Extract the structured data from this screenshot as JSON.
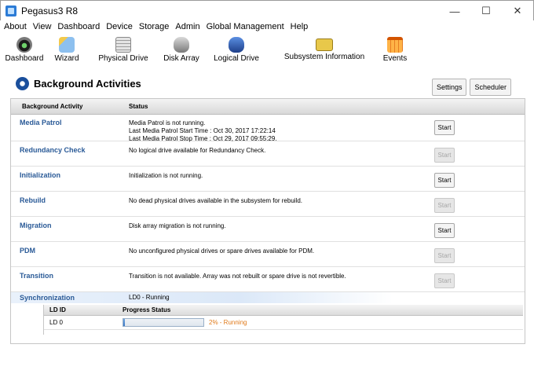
{
  "window": {
    "title": "Pegasus3 R8",
    "controls": {
      "minimize": "—",
      "maximize": "☐",
      "close": "✕"
    }
  },
  "menu": [
    "About",
    "View",
    "Dashboard",
    "Device",
    "Storage",
    "Admin",
    "Global Management",
    "Help"
  ],
  "toolbar": [
    {
      "label": "Dashboard",
      "icon": "dashboard-icon"
    },
    {
      "label": "Wizard",
      "icon": "wizard-icon"
    },
    {
      "label": "Physical Drive",
      "icon": "physical-drive-icon"
    },
    {
      "label": "Disk Array",
      "icon": "disk-array-icon"
    },
    {
      "label": "Logical Drive",
      "icon": "logical-drive-icon"
    },
    {
      "label": "Subsystem Information",
      "icon": "subsystem-info-icon"
    },
    {
      "label": "Events",
      "icon": "events-icon"
    }
  ],
  "panel": {
    "title": "Background Activities",
    "settings_label": "Settings",
    "scheduler_label": "Scheduler"
  },
  "grid": {
    "col_activity": "Background Activity",
    "col_status": "Status",
    "rows": [
      {
        "name": "Media Patrol",
        "status": [
          "Media Patrol is not running.",
          "Last Media Patrol Start Time : Oct 30, 2017 17:22:14",
          "Last Media Patrol Stop Time : Oct 29, 2017 09:55:29."
        ],
        "start_label": "Start",
        "enabled": true
      },
      {
        "name": "Redundancy Check",
        "status": [
          "No logical drive available for Redundancy Check."
        ],
        "start_label": "Start",
        "enabled": false
      },
      {
        "name": "Initialization",
        "status": [
          "Initialization is not running."
        ],
        "start_label": "Start",
        "enabled": true
      },
      {
        "name": "Rebuild",
        "status": [
          "No dead physical drives available in the subsystem for rebuild."
        ],
        "start_label": "Start",
        "enabled": false
      },
      {
        "name": "Migration",
        "status": [
          "Disk array migration is not running."
        ],
        "start_label": "Start",
        "enabled": true
      },
      {
        "name": "PDM",
        "status": [
          "No unconfigured physical drives or spare drives available for PDM."
        ],
        "start_label": "Start",
        "enabled": false
      },
      {
        "name": "Transition",
        "status": [
          "Transition is not available. Array was not rebuilt or spare drive is not revertible."
        ],
        "start_label": "Start",
        "enabled": false
      }
    ],
    "sync": {
      "name": "Synchronization",
      "status": "LD0 - Running",
      "col_ld": "LD ID",
      "col_progress": "Progress Status",
      "ld_id": "LD 0",
      "progress": 0.02,
      "progress_text": "2% - Running"
    }
  }
}
